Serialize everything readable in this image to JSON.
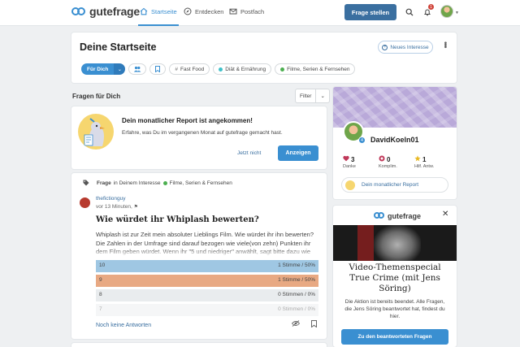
{
  "header": {
    "logo_text": "gutefrage",
    "nav": [
      {
        "label": "Startseite",
        "icon": "home-icon"
      },
      {
        "label": "Entdecken",
        "icon": "compass-icon"
      },
      {
        "label": "Postfach",
        "icon": "mail-icon"
      }
    ],
    "ask_label": "Frage stellen",
    "notification_count": "1"
  },
  "start": {
    "title": "Deine Startseite",
    "new_interest": "Neues Interesse",
    "chips": {
      "main": "Für Dich",
      "fast_food": "Fast Food",
      "diet": "Diät & Ernährung",
      "movies": "Filme, Serien & Fernsehen"
    }
  },
  "feed": {
    "section_title": "Fragen für Dich",
    "filter_label": "Filter"
  },
  "report": {
    "title": "Dein monatlicher Report ist angekommen!",
    "text": "Erfahre, was Du im vergangenen Monat auf gutefrage gemacht hast.",
    "later": "Jetzt nicht",
    "show": "Anzeigen"
  },
  "question": {
    "meta_prefix": "Frage",
    "meta_mid": "in Deinem Interesse",
    "topic": "Filme, Serien & Fernsehen",
    "author": "thefictionguy",
    "time": "vor 13 Minuten,",
    "title": "Wie würdet ihr Whiplash bewerten?",
    "body": "Whiplash ist zur Zeit mein absoluter Lieblings Film. Wie würdet ihr ihn bewerten? Die Zahlen in der Umfrage sind darauf bezogen wie viele(von zehn) Punkten ihr dem Film geben würdet. Wenn ihr \"5 und niedriger\" anwählt, sagt bitte dazu wie",
    "poll": [
      {
        "option": "10",
        "result": "1 Stimme / 50%",
        "percent": 50,
        "color": "#9fc7e3"
      },
      {
        "option": "9",
        "result": "1 Stimme / 50%",
        "percent": 50,
        "color": "#e8a983"
      },
      {
        "option": "8",
        "result": "0 Stimmen / 0%",
        "percent": 0,
        "color": "#e9ecee"
      },
      {
        "option": "7",
        "result": "0 Stimmen / 0%",
        "percent": 0,
        "color": "#e9ecee"
      }
    ],
    "no_answers": "Noch keine Antworten"
  },
  "profile": {
    "name": "DavidKoeln01",
    "level_badge": "4",
    "stats": [
      {
        "value": "3",
        "label": "Danke",
        "icon": "heart-icon",
        "color": "#c0395a"
      },
      {
        "value": "0",
        "label": "Komplim.",
        "icon": "compliment-icon",
        "color": "#c0395a"
      },
      {
        "value": "1",
        "label": "Hilf. Antw.",
        "icon": "star-icon",
        "color": "#e8b923"
      }
    ],
    "report_link": "Dein monatlicher Report"
  },
  "ad": {
    "logo_text": "gutefrage",
    "title": "Video-Themenspecial True Crime (mit Jens Söring)",
    "text": "Die Aktion ist bereits beendet. Alle Fragen, die Jens Söring beantwortet hat, findest du hier.",
    "button": "Zu den beantworteten Fragen"
  }
}
